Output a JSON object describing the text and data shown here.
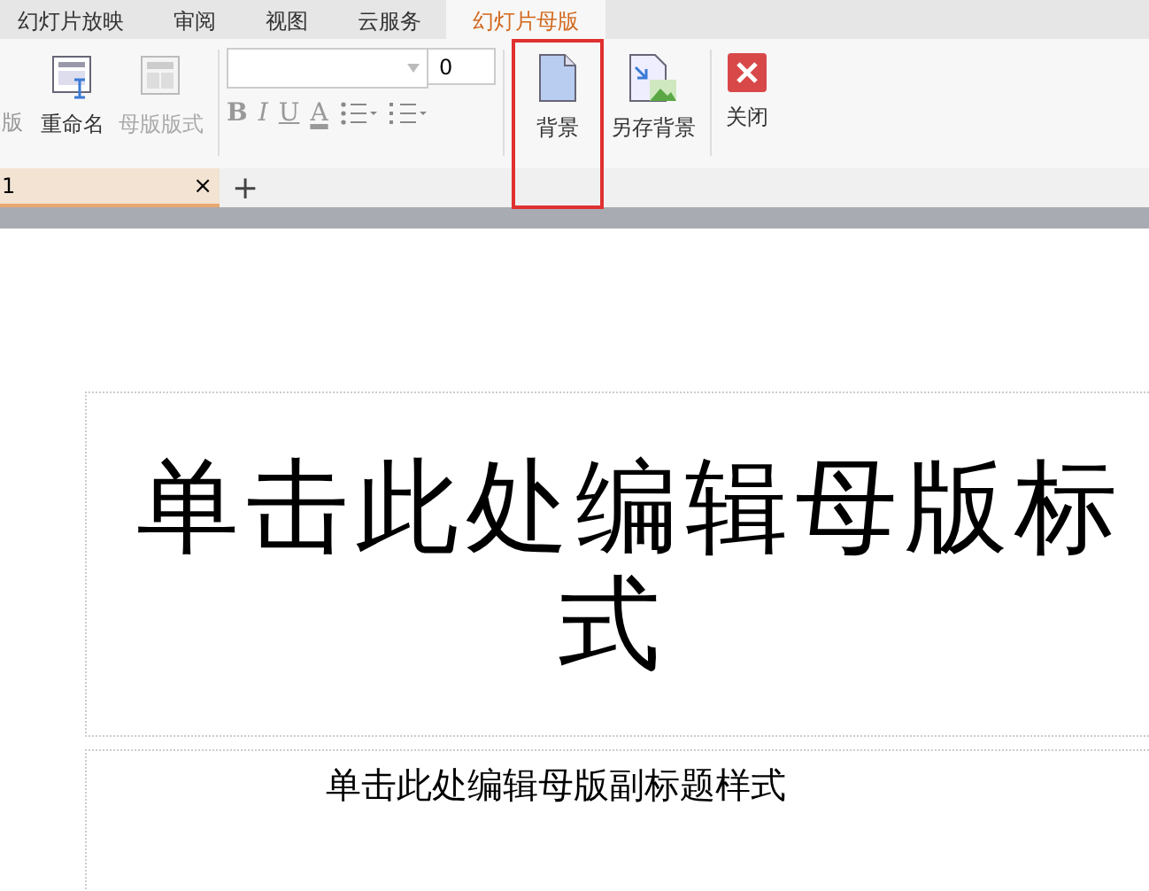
{
  "menu_tabs": [
    {
      "label": "幻灯片放映",
      "selected": false
    },
    {
      "label": "审阅",
      "selected": false
    },
    {
      "label": "视图",
      "selected": false
    },
    {
      "label": "云服务",
      "selected": false
    },
    {
      "label": "幻灯片母版",
      "selected": true
    }
  ],
  "ribbon": {
    "cut_label": "版",
    "buttons": [
      {
        "kind": "rename",
        "label": "重命名",
        "disabled": false
      },
      {
        "kind": "layout",
        "label": "母版版式",
        "disabled": true
      }
    ],
    "font_size": "0",
    "format_buttons": [
      {
        "kind": "bold",
        "label": "B"
      },
      {
        "kind": "italic",
        "label": "I"
      },
      {
        "kind": "underline",
        "label": "U"
      },
      {
        "kind": "color",
        "label": "A"
      }
    ],
    "bg_buttons": [
      {
        "kind": "background",
        "label": "背景",
        "highlighted": true
      },
      {
        "kind": "save-background",
        "label": "另存背景",
        "highlighted": false
      }
    ],
    "close_button": {
      "label": "关闭"
    }
  },
  "doc_tabs": [
    {
      "label": "1",
      "selected": true,
      "close": "×"
    }
  ],
  "add_tab": "+",
  "slide": {
    "title_lines": [
      "单击此处编辑母版标",
      "式"
    ],
    "subtitle": "单击此处编辑母版副标题样式"
  }
}
